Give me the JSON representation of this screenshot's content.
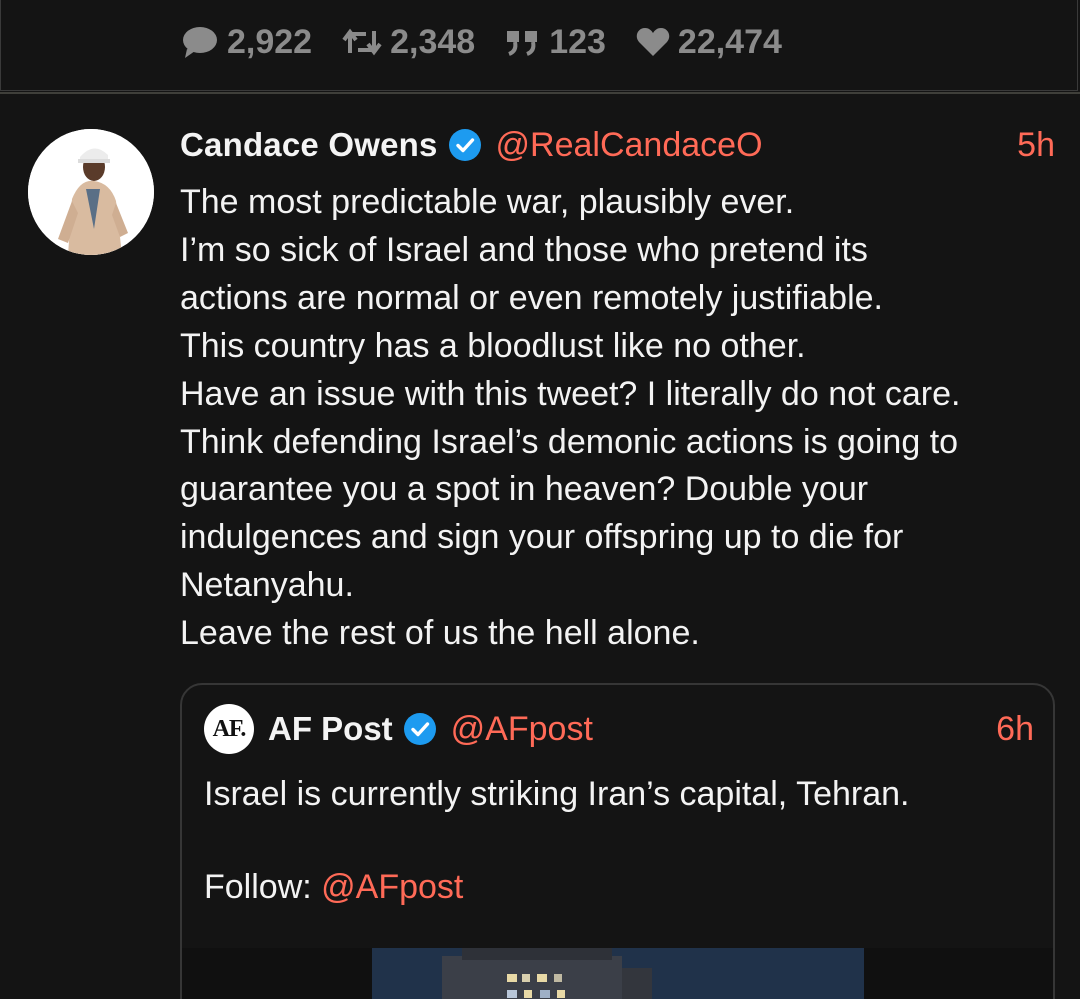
{
  "previous_tweet": {
    "stats": {
      "replies": "2,922",
      "retweets": "2,348",
      "quotes": "123",
      "likes": "22,474"
    },
    "icons": [
      "comment-icon",
      "retweet-icon",
      "quote-icon",
      "heart-icon"
    ]
  },
  "tweet": {
    "author_name": "Candace Owens",
    "handle": "@RealCandaceO",
    "time": "5h",
    "verified": true,
    "lines": [
      "The most predictable war, plausibly ever.",
      "I’m so sick of Israel and those who pretend its",
      "actions are normal or even remotely justifiable.",
      "This country has a bloodlust like no other.",
      "Have an issue with this tweet? I literally do not care.",
      "Think defending Israel’s demonic actions is going to",
      "guarantee you a spot in heaven? Double your",
      "indulgences and sign your offspring up to die for",
      "Netanyahu.",
      "Leave the rest of us the hell alone."
    ]
  },
  "quoted_tweet": {
    "logo_text": "AF.",
    "author_name": "AF Post",
    "handle": "@AFpost",
    "time": "6h",
    "verified": true,
    "text": "Israel is currently striking Iran’s capital, Tehran.",
    "follow_label": "Follow: ",
    "follow_mention": "@AFpost"
  },
  "colors": {
    "background": "#141414",
    "accent": "#ff6a57",
    "muted": "#8b8b8b",
    "verified_badge": "#1d9bf0",
    "border": "#363636"
  }
}
